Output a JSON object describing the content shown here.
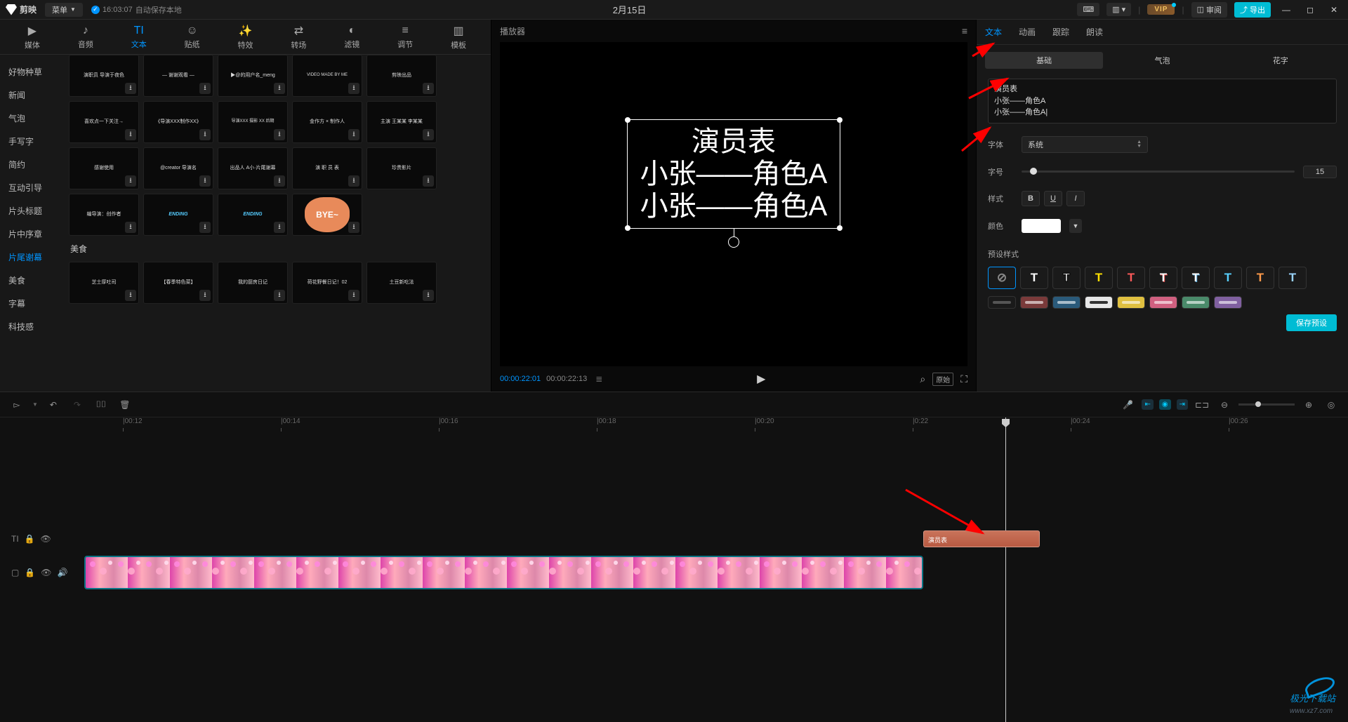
{
  "titlebar": {
    "logo_text": "剪映",
    "menu_label": "菜单",
    "autosave_time": "16:03:07",
    "autosave_label": "自动保存本地",
    "project_title": "2月15日",
    "vip_label": "VIP",
    "review_label": "审阅",
    "export_label": "导出"
  },
  "top_tabs": [
    {
      "icon": "▶",
      "label": "媒体"
    },
    {
      "icon": "♪",
      "label": "音频"
    },
    {
      "icon": "TI",
      "label": "文本"
    },
    {
      "icon": "☺",
      "label": "贴纸"
    },
    {
      "icon": "✨",
      "label": "特效"
    },
    {
      "icon": "⇄",
      "label": "转场"
    },
    {
      "icon": "◐",
      "label": "滤镜"
    },
    {
      "icon": "≡",
      "label": "调节"
    },
    {
      "icon": "▥",
      "label": "模板"
    }
  ],
  "categories": [
    "好物种草",
    "新闻",
    "气泡",
    "手写字",
    "简约",
    "互动引导",
    "片头标题",
    "片中序章",
    "片尾谢幕",
    "美食",
    "字幕",
    "科技感"
  ],
  "active_category": "片尾谢幕",
  "grid_section_label": "美食",
  "tpl_thumbs": [
    "演职员 导演于夜色",
    "— 谢谢观看 —",
    "▶@的用户名_meng",
    "VIDEO MADE BY ME",
    "剪映出品",
    "喜欢点一下关注→",
    "《导演XXX制作XX》",
    "导演XXX 摄影 XX 后期",
    "金作方 × 制作人",
    "主演 王某某 李某某",
    "感谢使用",
    "@creator 导演名",
    "出品人 A小·片尾谢幕",
    "演 职 员 表",
    "珍贵影片",
    "编导演：创作者",
    "ENDING",
    "ENDING",
    "BYE~",
    "芝士厚吐司",
    "【春季特色菜】",
    "我的厨房日记",
    "荷花野餐日记！02",
    "土豆新吃法"
  ],
  "player_header": "播放器",
  "preview_text": {
    "line1": "演员表",
    "line2": "小张——角色A",
    "line3": "小张——角色A"
  },
  "playback": {
    "current": "00:00:22:01",
    "total": "00:00:22:13",
    "ratio": "原始"
  },
  "right_tabs": [
    "文本",
    "动画",
    "跟踪",
    "朗读"
  ],
  "right_subtabs": [
    "基础",
    "气泡",
    "花字"
  ],
  "text_edit": {
    "line1": "演员表",
    "line2": "小张——角色A",
    "line3": "小张——角色A"
  },
  "props": {
    "font_label": "字体",
    "font_value": "系统",
    "size_label": "字号",
    "size_value": "15",
    "style_label": "样式",
    "color_label": "颜色",
    "preset_label": "预设样式",
    "save_preset": "保存预设"
  },
  "preset_styles": [
    {
      "txt": "⊘",
      "fg": "#888",
      "bg": "transparent"
    },
    {
      "txt": "T",
      "fg": "#fff",
      "bg": "transparent"
    },
    {
      "txt": "T",
      "fg": "#fff",
      "bg": "transparent",
      "outline": "#000"
    },
    {
      "txt": "T",
      "fg": "#ffe100",
      "bg": "transparent"
    },
    {
      "txt": "T",
      "fg": "#ff5a5a",
      "bg": "transparent"
    },
    {
      "txt": "T",
      "fg": "#fff",
      "bg": "transparent",
      "shadow": "#d44"
    },
    {
      "txt": "T",
      "fg": "#fff",
      "bg": "transparent",
      "shadow": "#5ad"
    },
    {
      "txt": "T",
      "fg": "#58d0ff",
      "bg": "transparent"
    },
    {
      "txt": "T",
      "fg": "#ff9a4a",
      "bg": "transparent"
    },
    {
      "txt": "T",
      "fg": "#9ad4ff",
      "bg": "transparent"
    }
  ],
  "preset_bg_row": [
    "",
    "#7a3a3a",
    "#2a5a7a",
    "#fff",
    "#e0c040",
    "#d06080",
    "#4a8a6a",
    "#8060a0"
  ],
  "ruler": [
    "|00:12",
    "|00:14",
    "|00:16",
    "|00:18",
    "|00:20",
    "|0:22",
    "|00:24",
    "|00:26"
  ],
  "text_clip_label": "演员表",
  "watermark": "极光下载站",
  "watermark_url": "www.xz7.com"
}
